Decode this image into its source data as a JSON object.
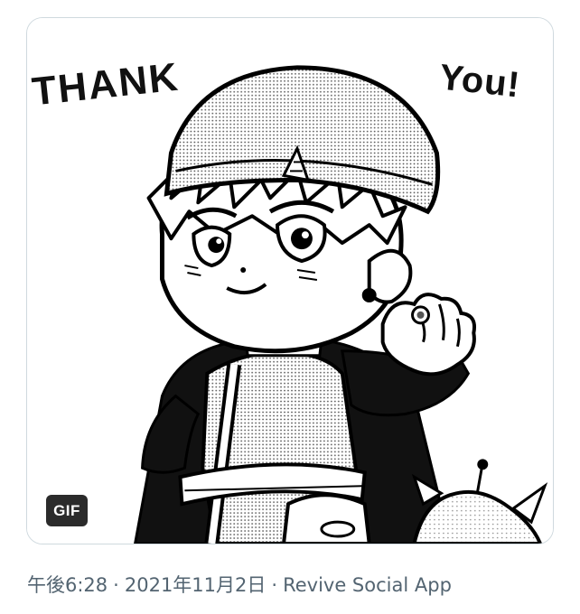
{
  "media": {
    "badge_label": "GIF",
    "caption_left": "THANK",
    "caption_right": "You!",
    "illustration": "manga-character-waving-icon"
  },
  "tweet_meta": {
    "time": "午後6:28",
    "separator": "·",
    "date": "2021年11月2日",
    "source": "Revive Social App"
  }
}
